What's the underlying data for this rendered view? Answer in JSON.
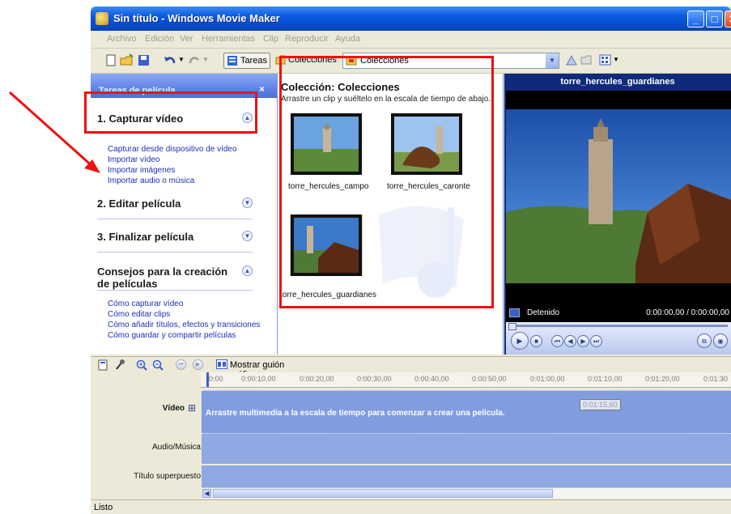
{
  "window": {
    "title": "Sin título - Windows Movie Maker"
  },
  "menu": [
    "Archivo",
    "Edición",
    "Ver",
    "Herramientas",
    "Clip",
    "Reproducir",
    "Ayuda"
  ],
  "toolbar": {
    "tasks_label": "Tareas",
    "collections_label": "Colecciones",
    "collection_dropdown_value": "Colecciones"
  },
  "tasks_pane": {
    "header": "Tareas de película",
    "close": "×",
    "sections": [
      {
        "title": "1. Capturar vídeo",
        "expanded": true,
        "links": [
          "Capturar desde dispositivo de vídeo",
          "Importar vídeo",
          "Importar imágenes",
          "Importar audio o música"
        ]
      },
      {
        "title": "2. Editar película",
        "expanded": false,
        "links": []
      },
      {
        "title": "3. Finalizar película",
        "expanded": false,
        "links": []
      },
      {
        "title": "Consejos para la creación de películas",
        "expanded": true,
        "links": [
          "Cómo capturar vídeo",
          "Cómo editar clips",
          "Cómo añadir títulos, efectos y transiciones",
          "Cómo guardar y compartir películas"
        ]
      }
    ]
  },
  "collection": {
    "title": "Colección: Colecciones",
    "subtitle": "Arrastre un clip y suéltelo en la escala de tiempo de abajo.",
    "clips": [
      "torre_hercules_campo",
      "torre_hercules_caronte",
      "torre_hercules_guardianes"
    ]
  },
  "preview": {
    "title": "torre_hercules_guardianes",
    "status": "Detenido",
    "time": "0:00:00,00 / 0:00:00,00"
  },
  "timeline": {
    "storyboard_label": "Mostrar guión gráfico",
    "ticks": [
      "0:00",
      "0:00:10,00",
      "0:00:20,00",
      "0:00:30,00",
      "0:00:40,00",
      "0:00:50,00",
      "0:01:00,00",
      "0:01:10,00",
      "0:01:20,00",
      "0:01:30"
    ],
    "tracks": [
      "Vídeo",
      "Audio/Música",
      "Título superpuesto"
    ],
    "video_hint": "Arrastre multimedia a la escala de tiempo para comenzar a crear una película.",
    "tooltip": "0:01:15,60",
    "expand": "⊞"
  },
  "statusbar": {
    "text": "Listo"
  },
  "colors": {
    "annotation": "#ee1111",
    "xp_blue": "#0a5ae0"
  }
}
